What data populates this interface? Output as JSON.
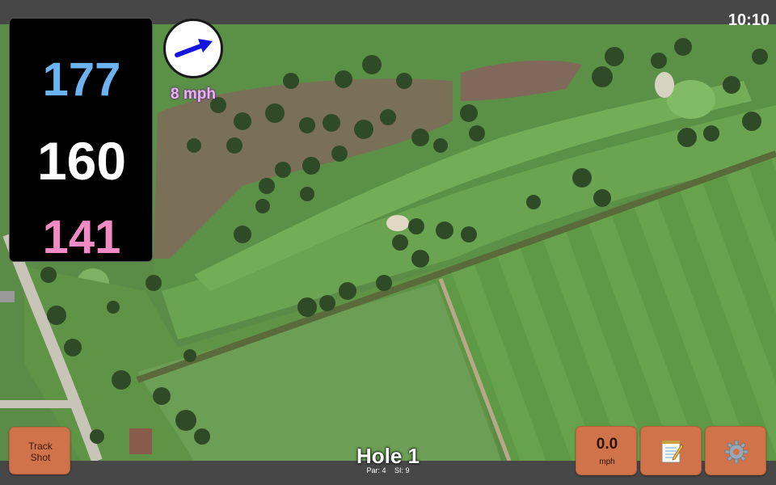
{
  "status_bar": {
    "time": "10:10"
  },
  "distances": {
    "back": "177",
    "center": "160",
    "front": "141"
  },
  "wind": {
    "speed": "8 mph",
    "arrow_icon": "wind-direction-arrow-icon",
    "arrow_color": "#1414e0"
  },
  "hole": {
    "title": "Hole 1",
    "par": "Par: 4",
    "stroke_index": "SI: 9"
  },
  "buttons": {
    "track_shot": "Track\nShot",
    "speed_value": "0.0",
    "speed_unit": "mph",
    "notes_icon": "notepad-icon",
    "settings_icon": "gear-icon"
  },
  "colors": {
    "button": "#d0734a",
    "back_distance": "#6bb3f2",
    "center_distance": "#ffffff",
    "front_distance": "#f28ac6",
    "wind_text": "#e9b3f2"
  }
}
